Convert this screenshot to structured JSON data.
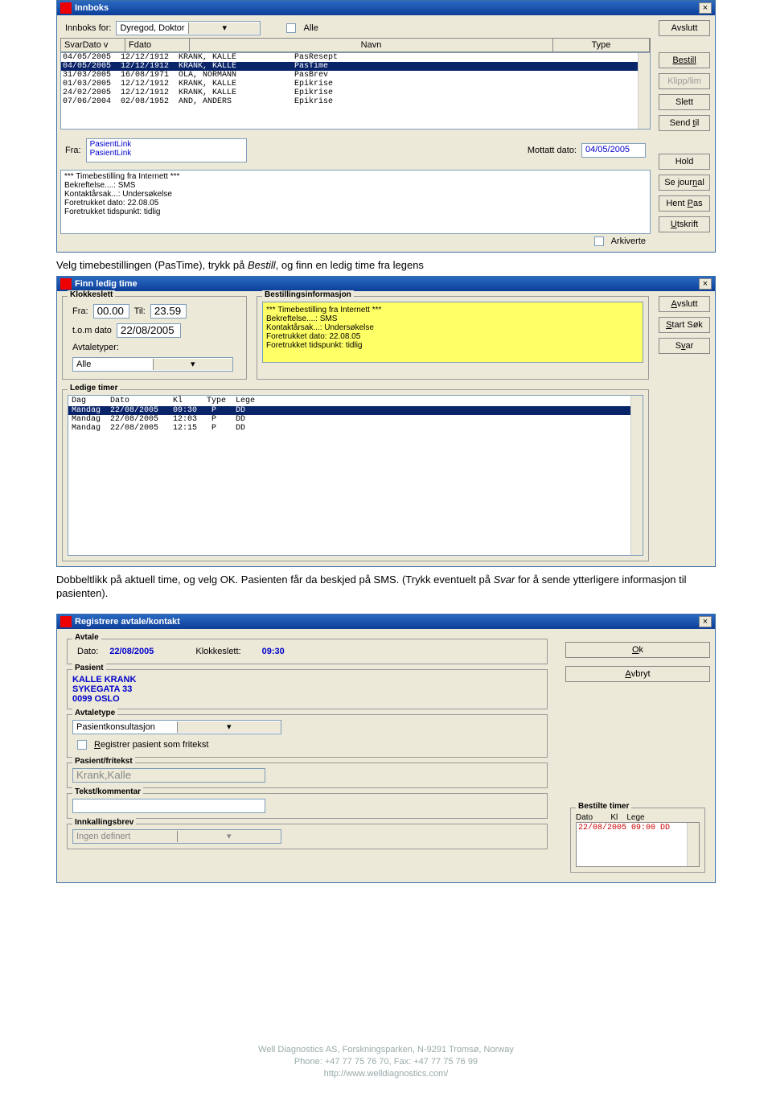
{
  "inbox": {
    "title": "Innboks",
    "for_label": "Innboks for:",
    "for_value": "Dyregod, Doktor",
    "all_label": "Alle",
    "cols": {
      "c1": "SvarDato v",
      "c2": "Fdato",
      "c3": "Navn",
      "c4": "Type"
    },
    "rows": [
      {
        "d1": "04/05/2005",
        "d2": "12/12/1912",
        "name": "KRANK, KALLE",
        "type": "PasResept"
      },
      {
        "d1": "04/05/2005",
        "d2": "12/12/1912",
        "name": "KRANK, KALLE",
        "type": "PasTime"
      },
      {
        "d1": "31/03/2005",
        "d2": "16/08/1971",
        "name": "OLA, NORMANN",
        "type": "PasBrev"
      },
      {
        "d1": "01/03/2005",
        "d2": "12/12/1912",
        "name": "KRANK, KALLE",
        "type": "Epikrise"
      },
      {
        "d1": "24/02/2005",
        "d2": "12/12/1912",
        "name": "KRANK, KALLE",
        "type": "Epikrise"
      },
      {
        "d1": "07/06/2004",
        "d2": "02/08/1952",
        "name": "AND, ANDERS",
        "type": "Epikrise"
      }
    ],
    "fra_label": "Fra:",
    "fra_value": "PasientLink\nPasientLink",
    "mottatt_label": "Mottatt dato:",
    "mottatt_value": "04/05/2005",
    "detail": "*** Timebestilling fra Internett ***\nBekreftelse....:    SMS\nKontaktårsak...:    Undersøkelse\nForetrukket dato:   22.08.05\nForetrukket tidspunkt: tidlig",
    "arkiverte": "Arkiverte",
    "buttons": {
      "avslutt": "Avslutt",
      "bestill": "Bestill",
      "klipp": "Klipp/lim",
      "slett": "Slett",
      "sendtil": "Send til",
      "hold": "Hold",
      "sejournal": "Se journal",
      "hentpas": "Hent Pas",
      "utskrift": "Utskrift"
    }
  },
  "prose1": "Velg timebestillingen (PasTime), trykk på ",
  "prose1b": "Bestill",
  "prose1c": ", og finn en ledig time fra legens",
  "flt": {
    "title": "Finn ledig time",
    "klokkeslett": "Klokkeslett",
    "fra_label": "Fra:",
    "fra_val": "00.00",
    "til_label": "Til:",
    "til_val": "23.59",
    "tom_label": "t.o.m dato",
    "tom_val": "22/08/2005",
    "avtaletyper": "Avtaletyper:",
    "avtale_val": "Alle",
    "bestinfo": "Bestillingsinformasjon",
    "info": "*** Timebestilling fra Internett ***\nBekreftelse....:    SMS\nKontaktårsak...:    Undersøkelse\nForetrukket dato:   22.08.05\nForetrukket tidspunkt: tidlig",
    "ledige": "Ledige timer",
    "lh": "Dag     Dato         Kl     Type  Lege",
    "lrows": [
      "Mandag  22/08/2005   09:30   P    DD",
      "Mandag  22/08/2005   12:03   P    DD",
      "Mandag  22/08/2005   12:15   P    DD"
    ],
    "buttons": {
      "avslutt": "Avslutt",
      "start": "Start Søk",
      "svar": "Svar"
    }
  },
  "prose2a": "Dobbeltlikk på aktuell time, og velg OK. Pasienten får da beskjed på SMS. (Trykk eventuelt på ",
  "prose2b": "Svar",
  "prose2c": " for å sende ytterligere informasjon til pasienten).",
  "reg": {
    "title": "Registrere avtale/kontakt",
    "avtale": "Avtale",
    "dato_label": "Dato:",
    "dato_val": "22/08/2005",
    "kl_label": "Klokkeslett:",
    "kl_val": "09:30",
    "pasient": "Pasient",
    "p1": "KALLE KRANK",
    "p2": "SYKEGATA 33",
    "p3": "0099 OSLO",
    "avtaletype": "Avtaletype",
    "avtaletype_val": "Pasientkonsultasjon",
    "regfri": "Registrer pasient som fritekst",
    "pasfri": "Pasient/fritekst",
    "pasfri_val": "Krank,Kalle",
    "tekst": "Tekst/kommentar",
    "innk": "Innkallingsbrev",
    "innk_val": "Ingen definert",
    "ok": "Ok",
    "avbryt": "Avbryt",
    "bestilte": "Bestilte timer",
    "bh": "Dato        Kl    Lege",
    "brow": "22/08/2005 09:00 DD"
  },
  "footer": {
    "l1": "Well Diagnostics AS, Forskningsparken, N-9291 Tromsø, Norway",
    "l2": "Phone: +47 77 75 76 70, Fax: +47 77 75 76 99",
    "l3": "http://www.welldiagnostics.com/"
  }
}
